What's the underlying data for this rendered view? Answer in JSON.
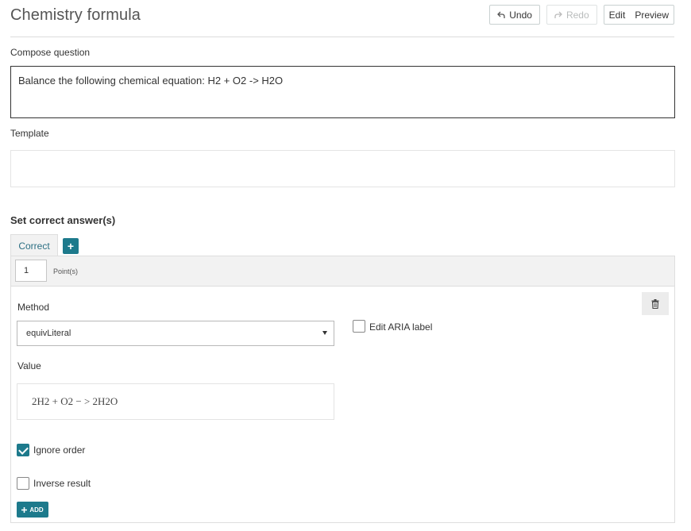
{
  "header": {
    "title": "Chemistry formula",
    "undo_label": "Undo",
    "redo_label": "Redo",
    "edit_label": "Edit",
    "preview_label": "Preview"
  },
  "compose": {
    "label": "Compose question",
    "text": "Balance the following chemical equation: H2 + O2 -> H2O"
  },
  "template": {
    "label": "Template",
    "value": ""
  },
  "answers": {
    "section_title": "Set correct answer(s)",
    "tab_label": "Correct",
    "add_tab_icon": "+",
    "points_value": "1",
    "points_label": "Point(s)",
    "method_label": "Method",
    "method_value": "equivLiteral",
    "aria_label": "Edit ARIA label",
    "value_label": "Value",
    "value_text": "2H2 + O2 − > 2H2O",
    "ignore_order_label": "Ignore order",
    "ignore_order_checked": true,
    "inverse_result_label": "Inverse result",
    "inverse_result_checked": false,
    "add_label": "ADD"
  },
  "colors": {
    "accent": "#1d7a8c",
    "tab_text": "#2c6f83"
  },
  "icons": {
    "undo": "undo-icon",
    "redo": "redo-icon",
    "delete": "trash-icon",
    "add": "plus-icon",
    "dropdown": "caret-down-icon",
    "check": "check-icon"
  }
}
